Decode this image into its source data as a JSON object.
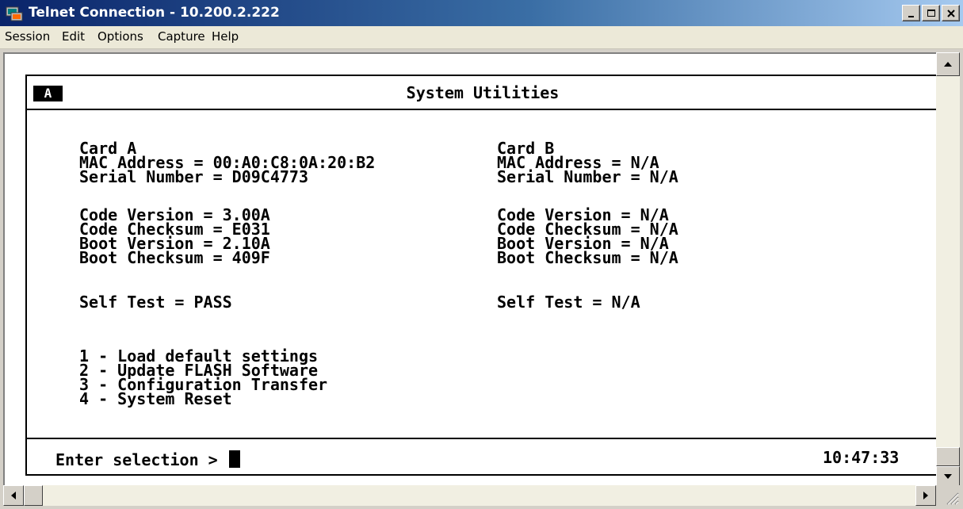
{
  "window": {
    "title": "Telnet Connection - 10.200.2.222",
    "buttons": [
      "minimize-icon",
      "maximize-icon",
      "close-icon"
    ]
  },
  "menu": [
    "Session",
    "Edit",
    "Options",
    "Capture",
    "Help"
  ],
  "terminal": {
    "badge": "A",
    "screen_title": "System Utilities",
    "card_a": {
      "header": "Card A",
      "mac": "MAC Address = 00:A0:C8:0A:20:B2",
      "serial": "Serial Number = D09C4773",
      "code_version": "Code Version = 3.00A",
      "code_checksum": "Code Checksum = E031",
      "boot_version": "Boot Version = 2.10A",
      "boot_checksum": "Boot Checksum = 409F",
      "self_test": "Self Test = PASS"
    },
    "card_b": {
      "header": "Card B",
      "mac": "MAC Address = N/A",
      "serial": "Serial Number = N/A",
      "code_version": "Code Version = N/A",
      "code_checksum": "Code Checksum = N/A",
      "boot_version": "Boot Version = N/A",
      "boot_checksum": "Boot Checksum = N/A",
      "self_test": "Self Test = N/A"
    },
    "options": [
      "1 - Load default settings",
      "2 - Update FLASH Software",
      "3 - Configuration Transfer",
      "4 - System Reset"
    ],
    "prompt": "Enter selection >",
    "time": "10:47:33"
  }
}
